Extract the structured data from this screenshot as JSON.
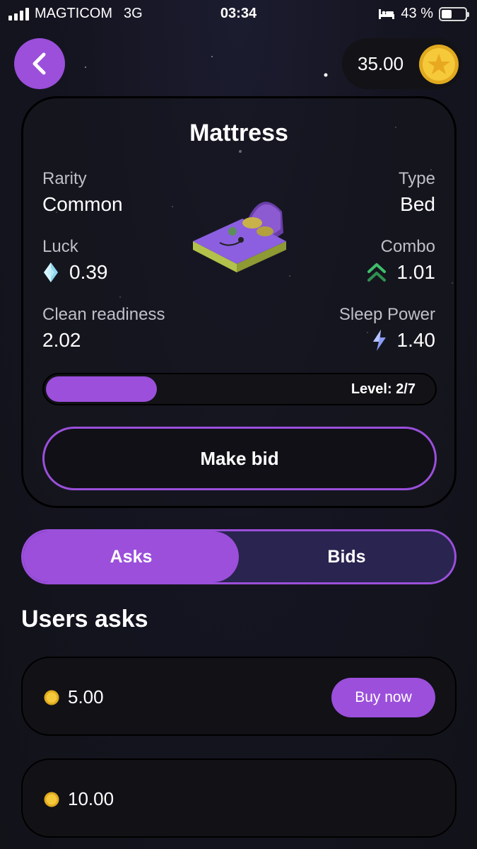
{
  "status_bar": {
    "carrier": "MAGTICOM",
    "network": "3G",
    "time": "03:34",
    "battery_percent": "43 %",
    "battery_level": 0.43
  },
  "header": {
    "back_icon": "chevron-left-icon",
    "balance": "35.00",
    "coin_icon": "star-coin-icon"
  },
  "item": {
    "name": "Mattress",
    "stats": {
      "rarity_label": "Rarity",
      "rarity_value": "Common",
      "type_label": "Type",
      "type_value": "Bed",
      "luck_label": "Luck",
      "luck_value": "0.39",
      "luck_icon": "diamond-icon",
      "combo_label": "Combo",
      "combo_value": "1.01",
      "combo_icon": "double-chevron-up-icon",
      "clean_label": "Clean readiness",
      "clean_value": "2.02",
      "sleep_label": "Sleep Power",
      "sleep_value": "1.40",
      "sleep_icon": "lightning-icon"
    },
    "level_text": "Level: 2/7",
    "level_current": 2,
    "level_max": 7,
    "make_bid_label": "Make bid"
  },
  "tabs": {
    "asks": "Asks",
    "bids": "Bids",
    "active": "asks"
  },
  "asks_section": {
    "title": "Users asks",
    "rows": [
      {
        "price": "5.00",
        "button": "Buy now"
      },
      {
        "price": "10.00"
      }
    ]
  },
  "colors": {
    "accent": "#9b4fdb",
    "coin": "#f2c230",
    "background": "#151522"
  }
}
